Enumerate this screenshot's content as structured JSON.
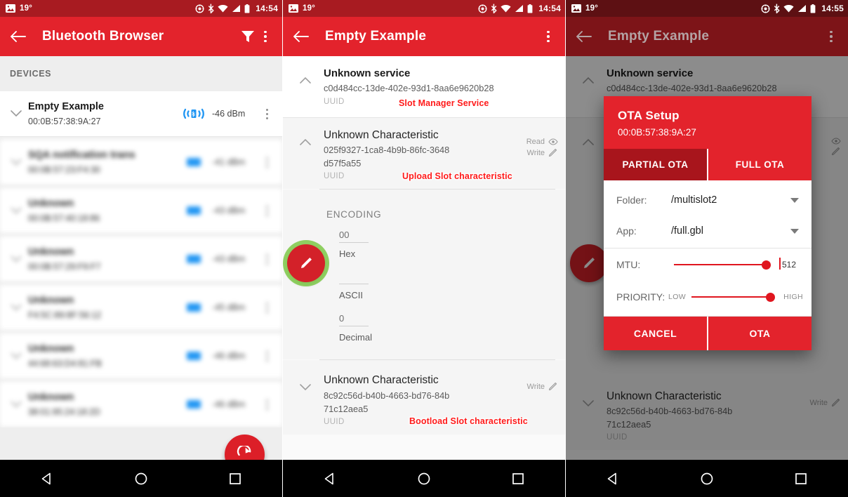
{
  "screen1": {
    "statusbar": {
      "temp": "19°",
      "time": "14:54",
      "icons": [
        "image-icon",
        "location-icon",
        "bluetooth-icon",
        "wifi-icon",
        "signal-icon",
        "battery-icon"
      ]
    },
    "appbar": {
      "title": "Bluetooth Browser",
      "back": "back-arrow-icon",
      "filter": "filter-icon",
      "overflow": "overflow-menu-icon"
    },
    "section_header": "DEVICES",
    "devices": [
      {
        "name": "Empty Example",
        "address": "00:0B:57:38:9A:27",
        "rssi": "-46 dBm",
        "blurred": false
      },
      {
        "name": "SQA notification trans",
        "address": "00:0B:57:23:F4:30",
        "rssi": "-41 dBm",
        "blurred": true
      },
      {
        "name": "Unknown",
        "address": "00:0B:57:40:18:86",
        "rssi": "-43 dBm",
        "blurred": true
      },
      {
        "name": "Unknown",
        "address": "00:0B:57:29:F9:F7",
        "rssi": "-43 dBm",
        "blurred": true
      },
      {
        "name": "Unknown",
        "address": "F4:5C:89:8F:56:12",
        "rssi": "-45 dBm",
        "blurred": true
      },
      {
        "name": "Unknown",
        "address": "44:68:63:D4:81:FB",
        "rssi": "-46 dBm",
        "blurred": true
      },
      {
        "name": "Unknown",
        "address": "38:01:95:24:18:2D",
        "rssi": "-46 dBm",
        "blurred": true
      }
    ],
    "fab": "refresh-icon"
  },
  "screen2": {
    "statusbar": {
      "temp": "19°",
      "time": "14:54"
    },
    "appbar": {
      "title": "Empty Example"
    },
    "service": {
      "title": "Unknown service",
      "uuid": "c0d484cc-13de-402e-93d1-8aa6e9620b28",
      "uuid_label": "UUID",
      "annotation": "Slot Manager Service"
    },
    "characteristic1": {
      "title": "Unknown Characteristic",
      "uuid": "025f9327-1ca8-4b9b-86fc-3648d57f5a55",
      "uuid_label": "UUID",
      "annotation": "Upload Slot characteristic",
      "props": [
        "Read",
        "Write"
      ],
      "encoding_title": "ENCODING",
      "fields": [
        {
          "value": "00",
          "label": "Hex"
        },
        {
          "value": "",
          "label": "ASCII"
        },
        {
          "value": "0",
          "label": "Decimal"
        }
      ]
    },
    "characteristic2": {
      "title": "Unknown Characteristic",
      "uuid": "8c92c56d-b40b-4663-bd76-84b71c12aea5",
      "uuid_label": "UUID",
      "annotation": "Bootload Slot characteristic",
      "props": [
        "Write"
      ]
    },
    "edit_fab": "pencil-icon"
  },
  "screen3": {
    "statusbar": {
      "temp": "19°",
      "time": "14:55"
    },
    "appbar": {
      "title": "Empty Example"
    },
    "service": {
      "title": "Unknown service",
      "uuid": "c0d484cc-13de-402e-93d1-8aa6e9620b28",
      "uuid_label": "UUID"
    },
    "characteristic2": {
      "title": "Unknown Characteristic",
      "uuid": "8c92c56d-b40b-4663-bd76-84b71c12aea5",
      "uuid_label": "UUID",
      "prop": "Write"
    },
    "dialog": {
      "title": "OTA Setup",
      "subtitle": "00:0B:57:38:9A:27",
      "tabs": [
        {
          "label": "PARTIAL OTA",
          "active": true
        },
        {
          "label": "FULL OTA",
          "active": false
        }
      ],
      "folder_label": "Folder:",
      "folder_value": "/multislot2",
      "app_label": "App:",
      "app_value": "/full.gbl",
      "mtu_label": "MTU:",
      "mtu_value": "512",
      "priority_label": "PRIORITY:",
      "priority_low": "LOW",
      "priority_high": "HIGH",
      "cancel": "CANCEL",
      "ota": "OTA"
    }
  },
  "navbar": {
    "back": "nav-back-icon",
    "home": "nav-home-icon",
    "recents": "nav-recents-icon"
  },
  "colors": {
    "primary": "#e3232c",
    "primary_dark": "#a81b21",
    "accent_red": "#dc1f28",
    "annotation": "#ff1a1a",
    "highlight_green": "#7cc846",
    "bluetooth_blue": "#2196f3"
  }
}
